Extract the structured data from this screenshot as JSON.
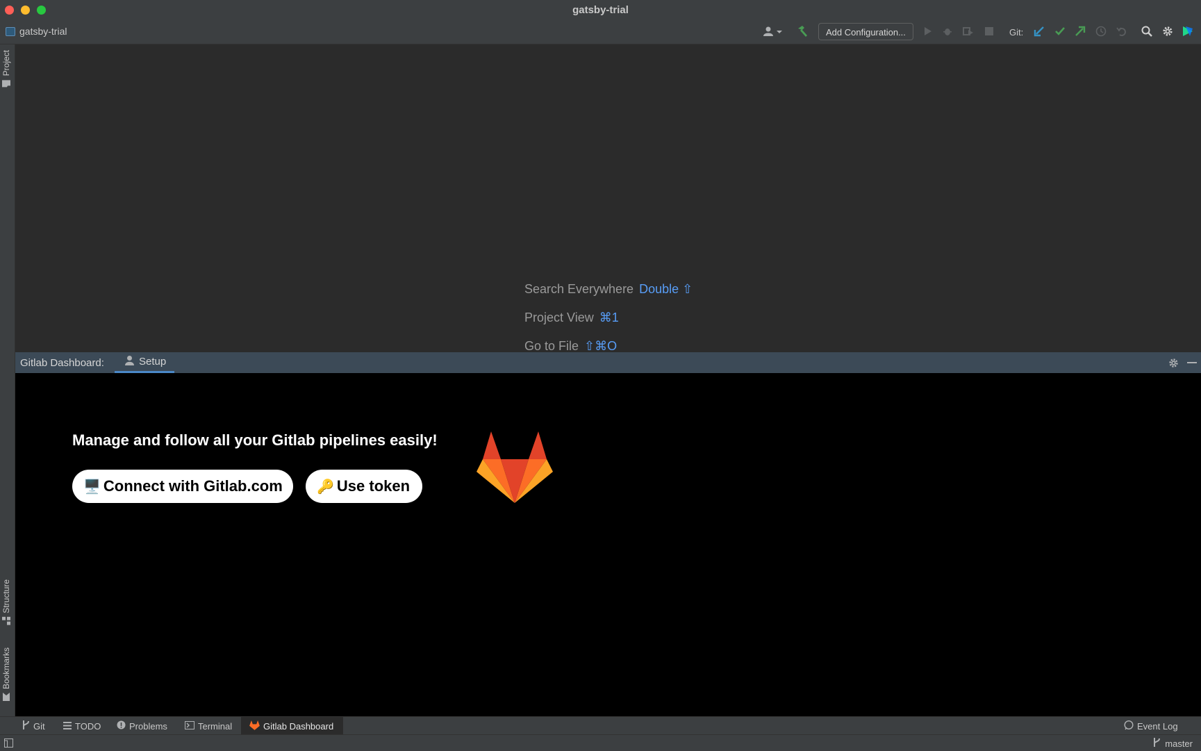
{
  "window": {
    "title": "gatsby-trial"
  },
  "navbar": {
    "project_name": "gatsby-trial",
    "add_configuration_label": "Add Configuration...",
    "git_label": "Git:"
  },
  "left_strip": {
    "project_label": "Project",
    "structure_label": "Structure",
    "bookmarks_label": "Bookmarks"
  },
  "editor_hints": [
    {
      "label": "Search Everywhere",
      "shortcut": "Double ⇧"
    },
    {
      "label": "Project View",
      "shortcut": "⌘1"
    },
    {
      "label": "Go to File",
      "shortcut": "⇧⌘O"
    }
  ],
  "gitlab_panel": {
    "title": "Gitlab Dashboard:",
    "tab_label": "Setup",
    "tagline": "Manage and follow all your Gitlab pipelines easily!",
    "connect_button": {
      "emoji": "🖥️",
      "label": "Connect with Gitlab.com"
    },
    "token_button": {
      "emoji": "🔑",
      "label": "Use token"
    }
  },
  "bottom_tabs": [
    {
      "label": "Git"
    },
    {
      "label": "TODO"
    },
    {
      "label": "Problems"
    },
    {
      "label": "Terminal"
    },
    {
      "label": "Gitlab Dashboard"
    }
  ],
  "event_log_label": "Event Log",
  "status": {
    "branch": "master"
  },
  "colors": {
    "accent_blue": "#589df6",
    "git_update": "#3592c4",
    "git_commit": "#499c54",
    "gitlab_orange": "#fc6d26"
  }
}
